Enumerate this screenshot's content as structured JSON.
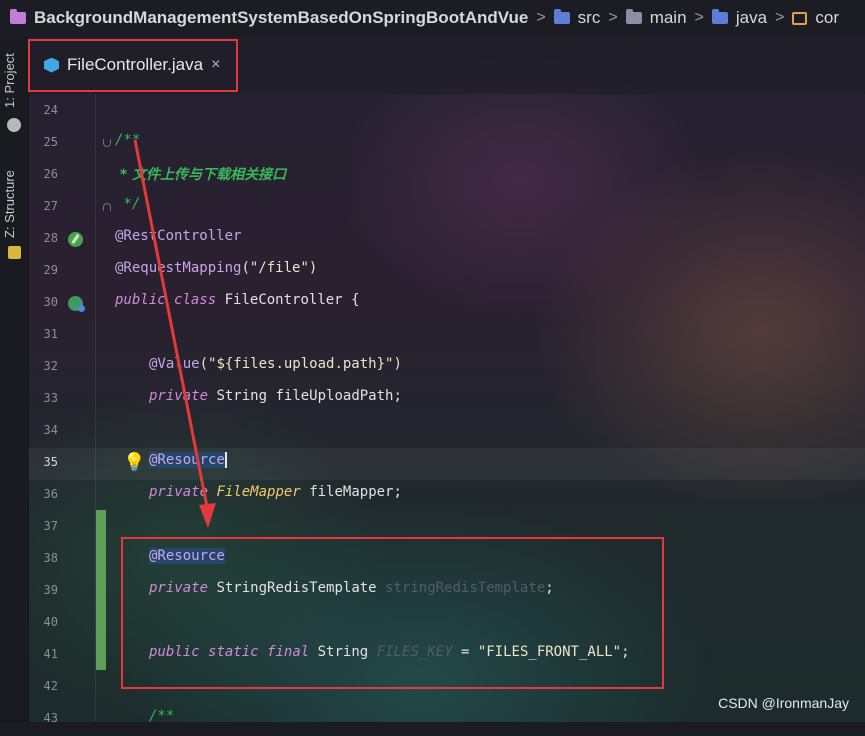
{
  "breadcrumb": {
    "project": "BackgroundManagementSystemBasedOnSpringBootAndVue",
    "src": "src",
    "main": "main",
    "java": "java",
    "pkg": "cor",
    "separator": ">"
  },
  "toolstrip": {
    "project_label": "1: Project",
    "structure_label": "Z: Structure"
  },
  "tab": {
    "filename": "FileController.java",
    "close": "×",
    "file_icon": "java-class-icon"
  },
  "gutter_icons": {
    "line_28": "spring-bean-leaf-icon",
    "line_30": "spring-bean-class-icon",
    "line_35": "lightbulb-icon"
  },
  "lines": [
    {
      "n": "24"
    },
    {
      "n": "25",
      "t": "/**"
    },
    {
      "n": "26",
      "t": " * 文件上传与下载相关接口"
    },
    {
      "n": "27",
      "t": " */"
    },
    {
      "n": "28",
      "t": "@RestController"
    },
    {
      "n": "29",
      "a": "@RequestMapping",
      "p1": "(",
      "s": "\"/file\"",
      "p2": ")"
    },
    {
      "n": "30",
      "k1": "public",
      "k2": "class",
      "id": "FileController",
      "b": "{"
    },
    {
      "n": "31"
    },
    {
      "n": "32",
      "a": "@Value",
      "p1": "(",
      "s": "\"${files.upload.path}\"",
      "p2": ")"
    },
    {
      "n": "33",
      "k": "private",
      "ty": "String",
      "id": "fileUploadPath",
      "e": ";"
    },
    {
      "n": "34"
    },
    {
      "n": "35",
      "a": "@Resource"
    },
    {
      "n": "36",
      "k": "private",
      "ty": "FileMapper",
      "id": "fileMapper",
      "e": ";"
    },
    {
      "n": "37"
    },
    {
      "n": "38",
      "a": "@Resource"
    },
    {
      "n": "39",
      "k": "private",
      "ty": "StringRedisTemplate",
      "id": "stringRedisTemplate",
      "e": ";"
    },
    {
      "n": "40"
    },
    {
      "n": "41",
      "k1": "public",
      "k2": "static",
      "k3": "final",
      "ty": "String",
      "id": "FILES_KEY",
      "eq": "=",
      "s": "\"FILES_FRONT_ALL\"",
      "e": ";"
    },
    {
      "n": "42"
    },
    {
      "n": "43",
      "t": "/**"
    }
  ],
  "watermark": "CSDN @IronmanJay",
  "colors": {
    "highlight_box": "#e23a3a",
    "arrow": "#e23a3a",
    "keyword": "#cf8ad8",
    "comment": "#38b858",
    "type": "#f2c96b",
    "changed_lines_bar": "#5e9f58"
  }
}
